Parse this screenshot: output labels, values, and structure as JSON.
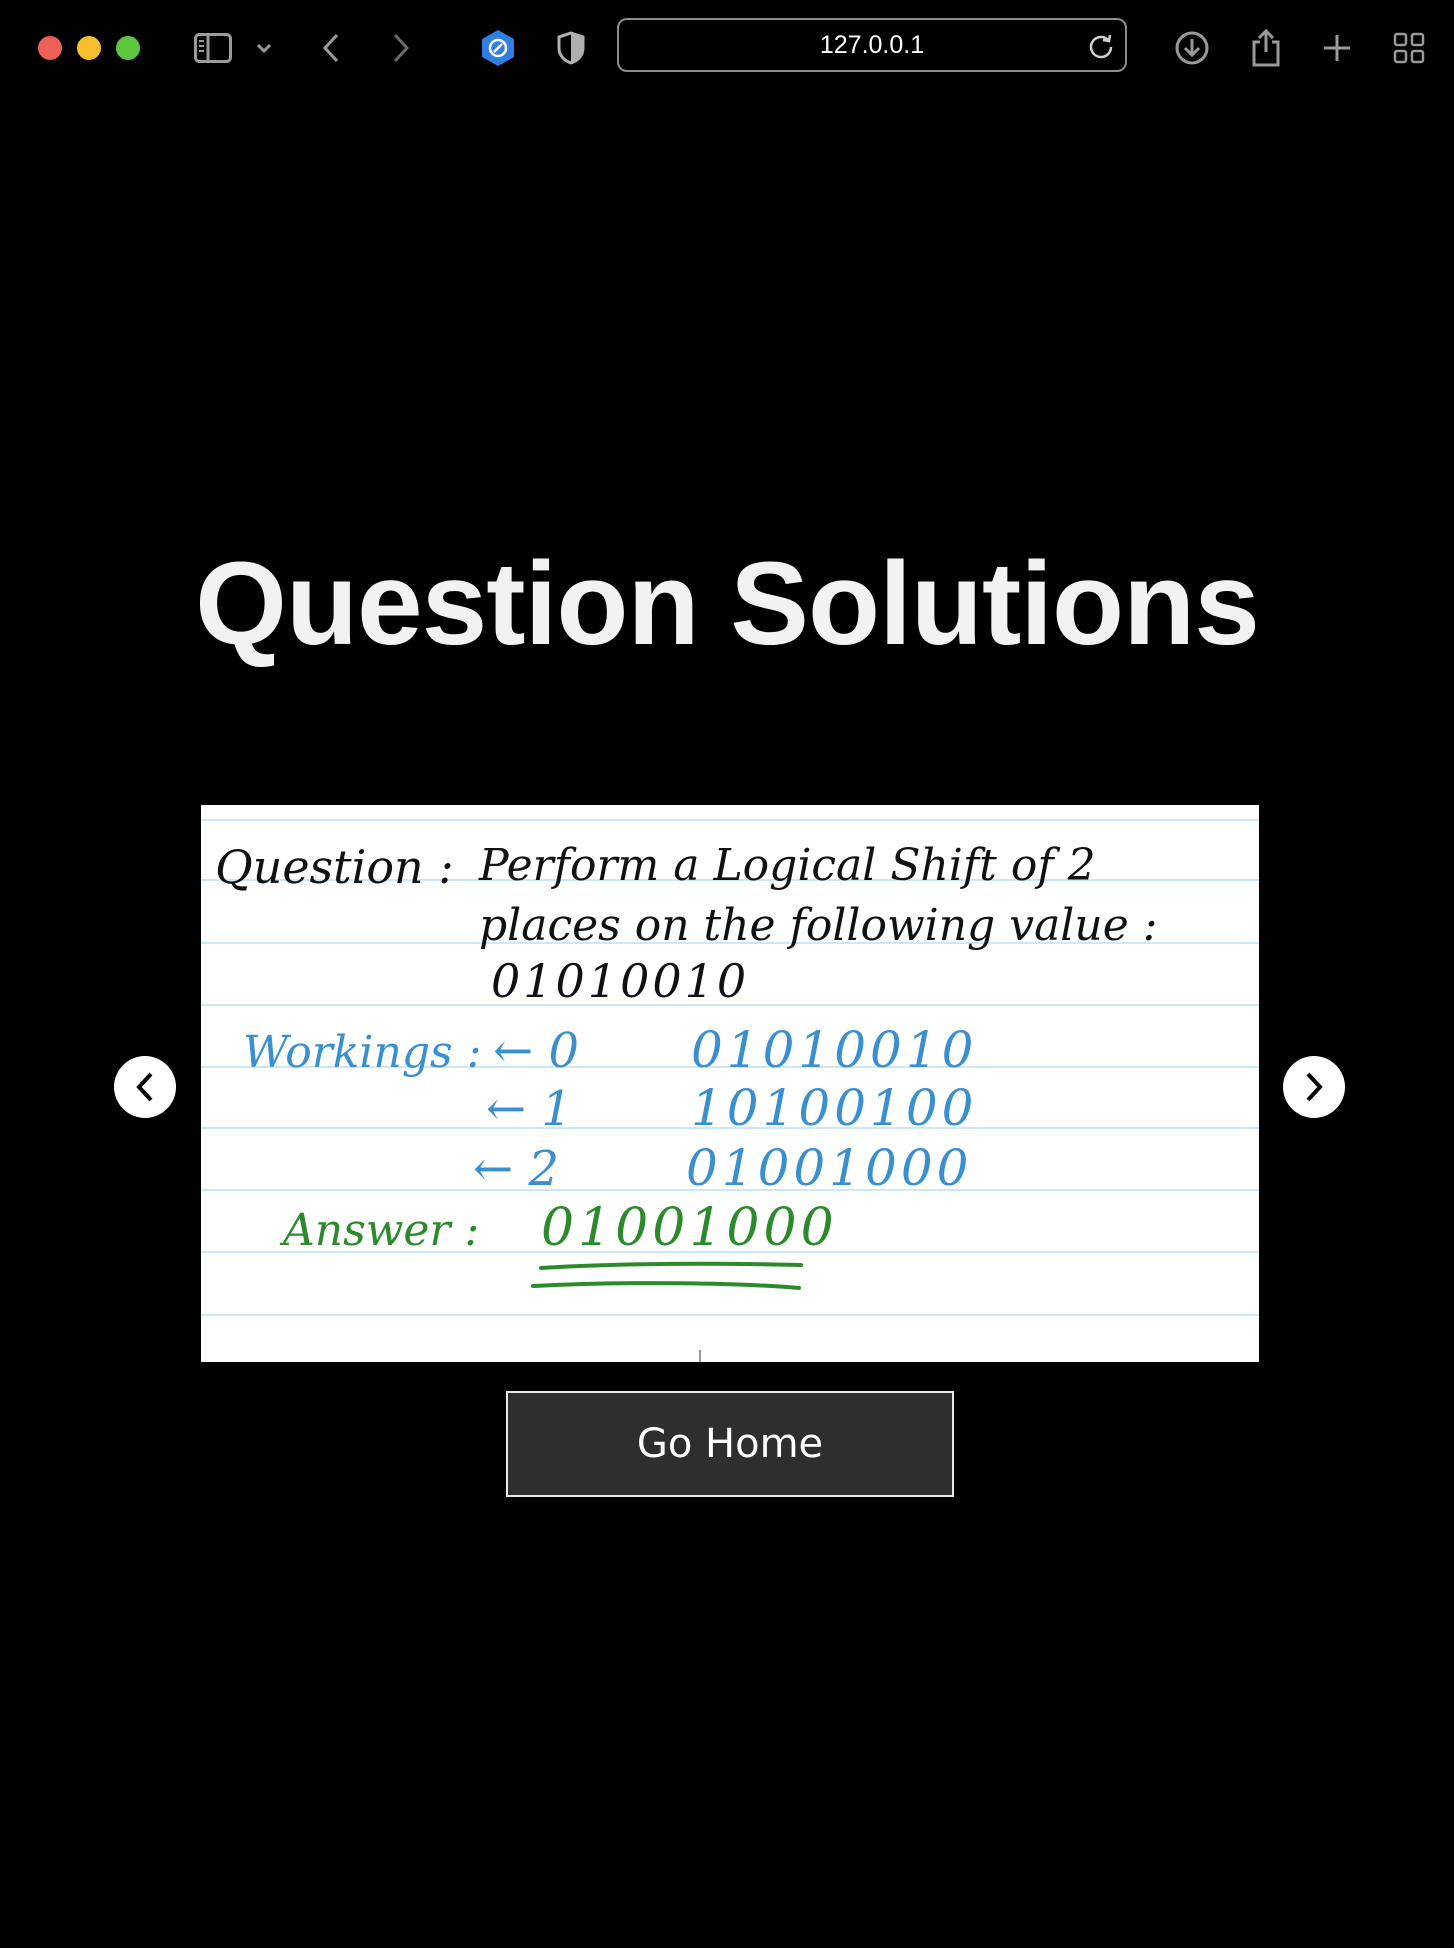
{
  "browser": {
    "url": "127.0.0.1",
    "icons": [
      "sidebar-icon",
      "chevron-down-icon",
      "back-icon",
      "forward-icon",
      "extension-icon",
      "shield-icon",
      "reload-icon",
      "download-icon",
      "share-icon",
      "new-tab-icon",
      "tab-overview-icon"
    ]
  },
  "page": {
    "title": "Question Solutions",
    "home_label": "Go Home"
  },
  "slide": {
    "question_label": "Question :",
    "question_text_1": "Perform a Logical Shift of 2",
    "question_text_2": "places on the following value :",
    "question_value": "01010010",
    "workings_label": "Workings :",
    "rows": [
      {
        "shift": "← 0",
        "value": "01010010"
      },
      {
        "shift": "← 1",
        "value": "10100100"
      },
      {
        "shift": "← 2",
        "value": "01001000"
      }
    ],
    "answer_label": "Answer :",
    "answer_value": "01001000",
    "colors": {
      "question": "#111111",
      "workings": "#3a8fcf",
      "answer": "#2c8a2c",
      "lines": "#cde8f5"
    }
  }
}
